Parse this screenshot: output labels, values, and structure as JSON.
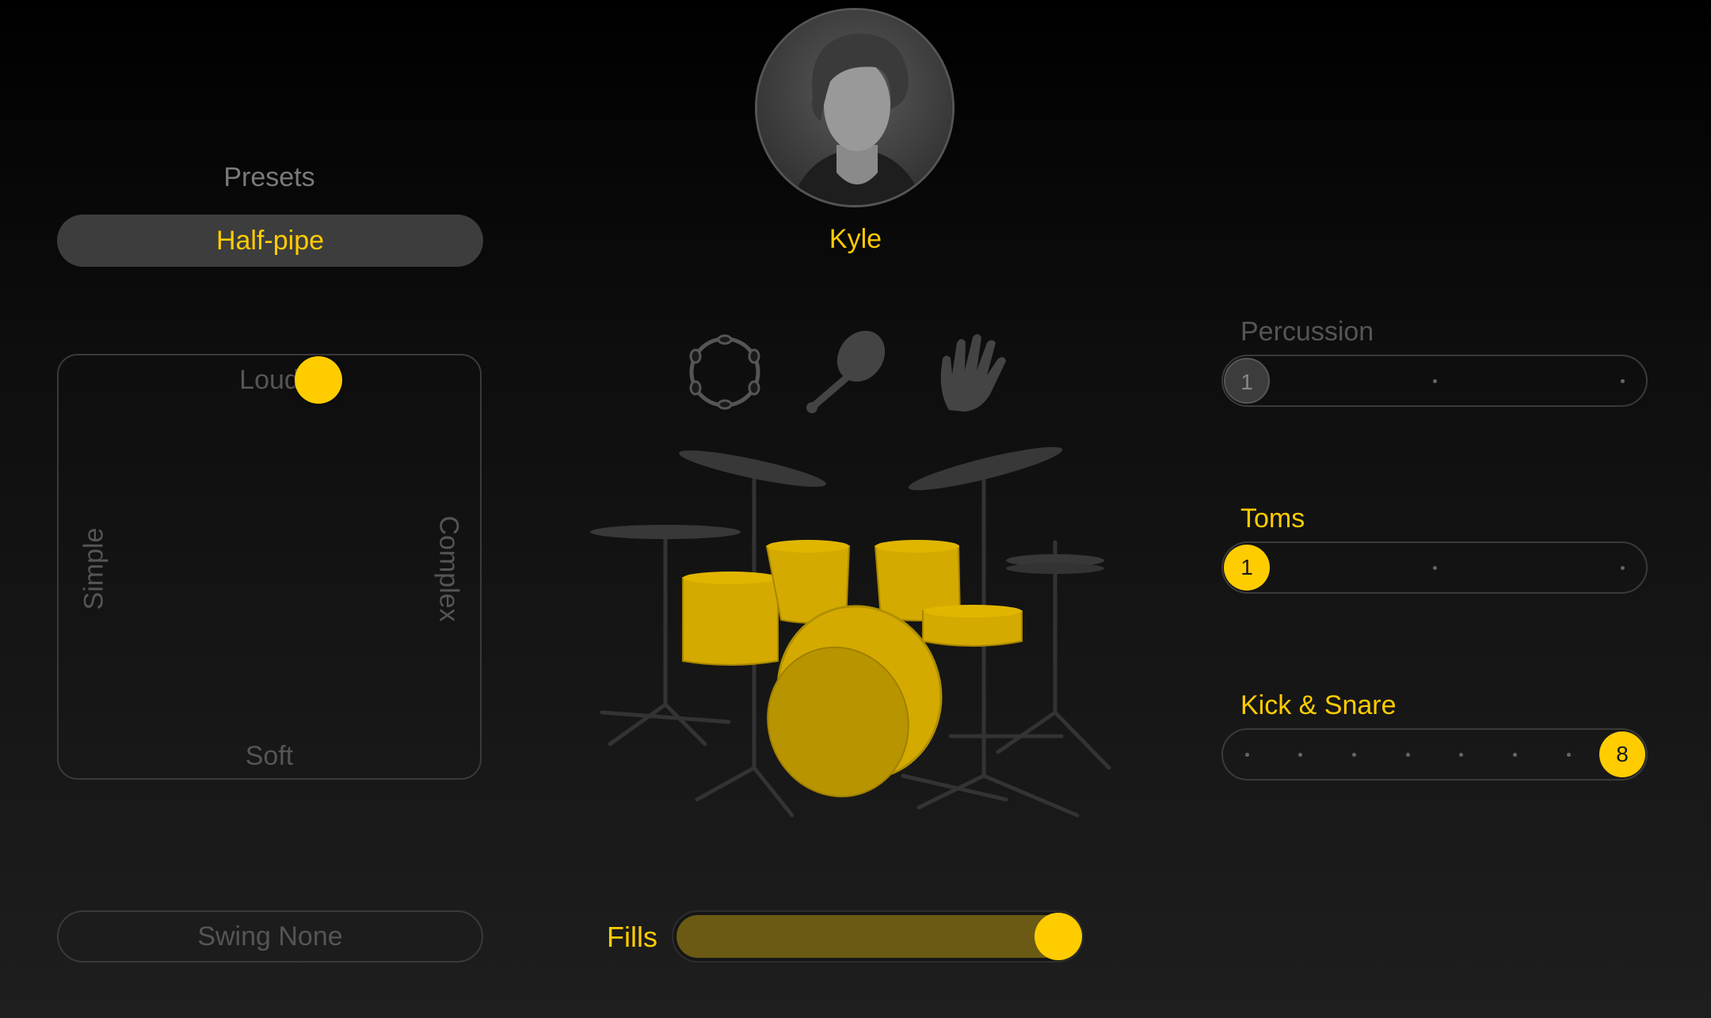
{
  "presets": {
    "title": "Presets",
    "selected": "Half-pipe"
  },
  "xy_pad": {
    "top_label": "Loud",
    "bottom_label": "Soft",
    "left_label": "Simple",
    "right_label": "Complex"
  },
  "swing": {
    "label": "Swing None"
  },
  "drummer": {
    "name": "Kyle"
  },
  "percussion_icons": [
    "tambourine-icon",
    "shaker-icon",
    "hand-clap-icon"
  ],
  "fills": {
    "label": "Fills",
    "level": 1.0
  },
  "sliders": {
    "percussion": {
      "title": "Percussion",
      "value": "1",
      "steps": 3,
      "active": false
    },
    "toms": {
      "title": "Toms",
      "value": "1",
      "steps": 3,
      "active": true
    },
    "kick_snare": {
      "title": "Kick & Snare",
      "value": "8",
      "steps": 8,
      "active": true
    }
  },
  "colors": {
    "accent": "#ffcc00",
    "drum_yellow": "#d4aa00",
    "hardware": "#3a3a3a",
    "background": "#111111"
  }
}
